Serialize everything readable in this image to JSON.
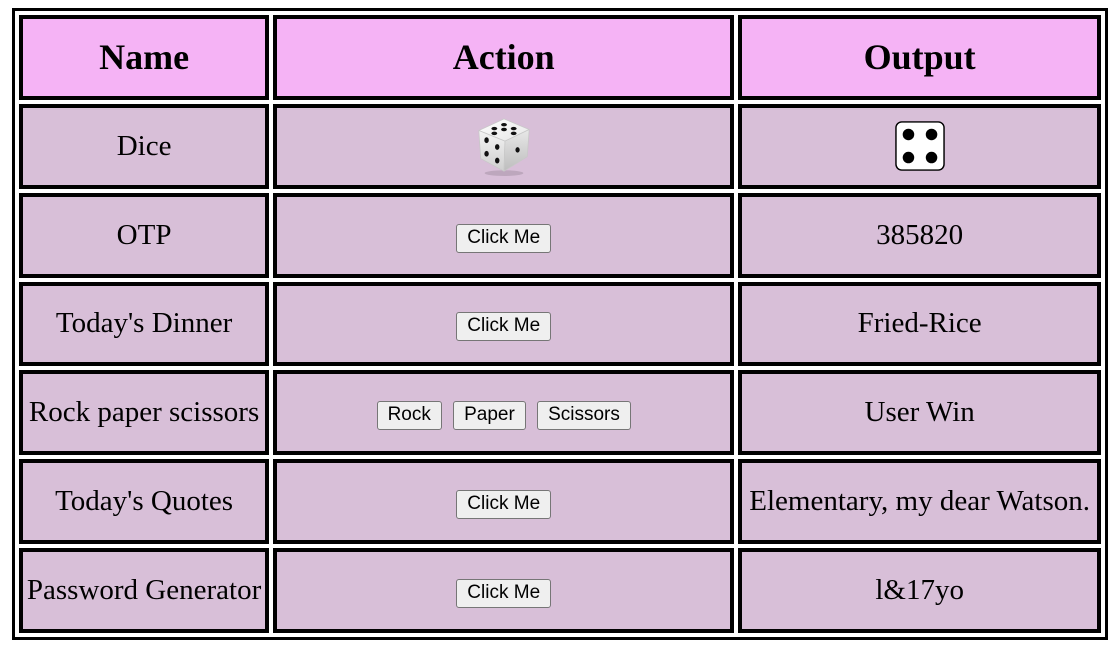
{
  "headers": {
    "name": "Name",
    "action": "Action",
    "output": "Output"
  },
  "rows": {
    "dice": {
      "name": "Dice",
      "action_icon": "3d-dice-icon",
      "output_icon": "die-face-four-icon",
      "output_value": 4
    },
    "otp": {
      "name": "OTP",
      "button": "Click Me",
      "output": "385820"
    },
    "dinner": {
      "name": "Today's Dinner",
      "button": "Click Me",
      "output": "Fried-Rice"
    },
    "rps": {
      "name": "Rock paper scissors",
      "buttons": [
        "Rock",
        "Paper",
        "Scissors"
      ],
      "output": "User Win"
    },
    "quotes": {
      "name": "Today's Quotes",
      "button": "Click Me",
      "output": "Elementary, my dear Watson."
    },
    "password": {
      "name": "Password Generator",
      "button": "Click Me",
      "output": "l&17yo"
    }
  },
  "colors": {
    "header_bg": "#f5b3f5",
    "cell_bg": "#d8bfd8",
    "border": "#000000"
  }
}
